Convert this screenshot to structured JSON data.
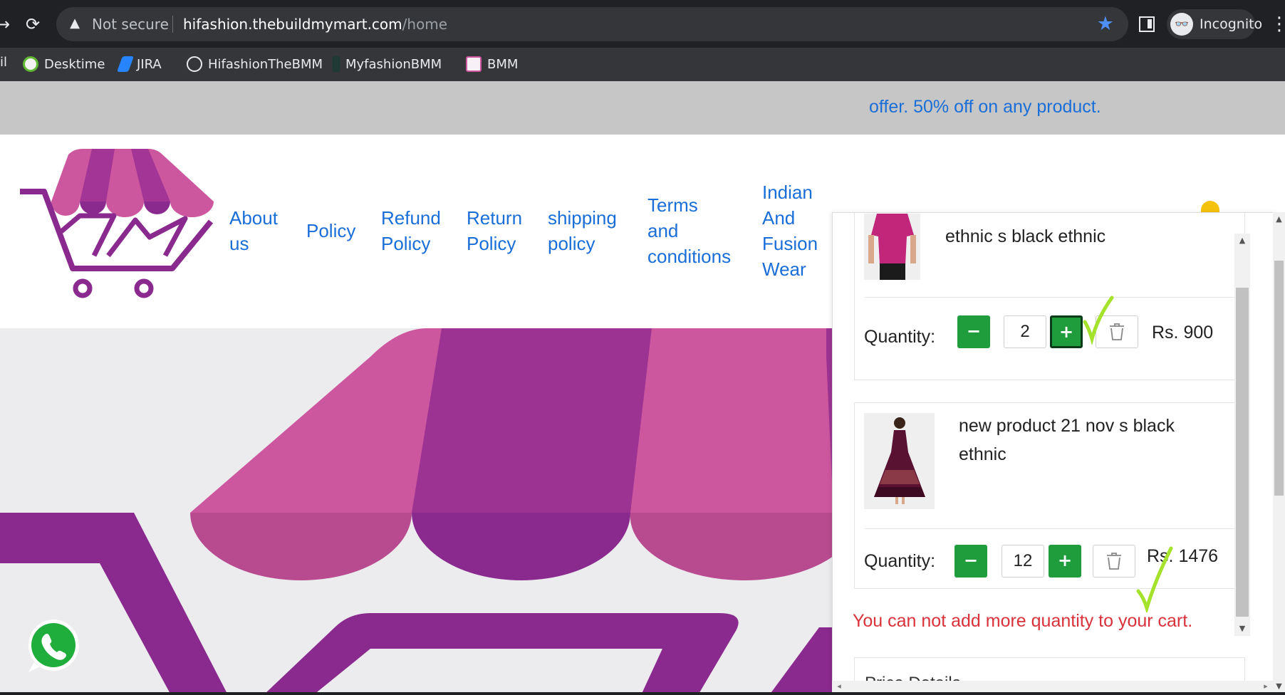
{
  "browser": {
    "security_label": "Not secure",
    "url_host": "hifashion.thebuildmymart.com",
    "url_path": "/home",
    "incognito_label": "Incognito",
    "bookmarks_edge": "il",
    "bookmarks": [
      {
        "label": "Desktime",
        "icon": "desktime-icon"
      },
      {
        "label": "JIRA",
        "icon": "jira-icon"
      },
      {
        "label": "HifashionTheBMM",
        "icon": "globe-icon"
      },
      {
        "label": "MyfashionBMM",
        "icon": "myfashion-icon"
      },
      {
        "label": "BMM",
        "icon": "bmm-icon"
      }
    ]
  },
  "offer": {
    "text": "offer. 50% off on any product."
  },
  "nav": {
    "about": [
      "About",
      "us"
    ],
    "policy": [
      "Policy"
    ],
    "refund": [
      "Refund",
      "Policy"
    ],
    "return": [
      "Return",
      "Policy"
    ],
    "shipping": [
      "shipping",
      "policy"
    ],
    "terms": [
      "Terms",
      "and",
      "conditions"
    ],
    "indian": [
      "Indian",
      "And",
      "Fusion",
      "Wear"
    ]
  },
  "cart": {
    "qty_label": "Quantity:",
    "items": [
      {
        "name": "ethnic s black ethnic",
        "quantity": "2",
        "price": "Rs. 900"
      },
      {
        "name_lines": [
          "new product 21 nov s black",
          "ethnic"
        ],
        "quantity": "12",
        "price": "Rs. 1476"
      }
    ],
    "message": "You can not add more quantity to your cart.",
    "price_details_title": "Price Details"
  },
  "colors": {
    "brand_pink": "#cd579f",
    "brand_purple": "#8a2a8e",
    "link_blue": "#1a6ed8",
    "button_green": "#1f9c3b",
    "error_red": "#d9323a",
    "annotation_green": "#a4e22b"
  }
}
